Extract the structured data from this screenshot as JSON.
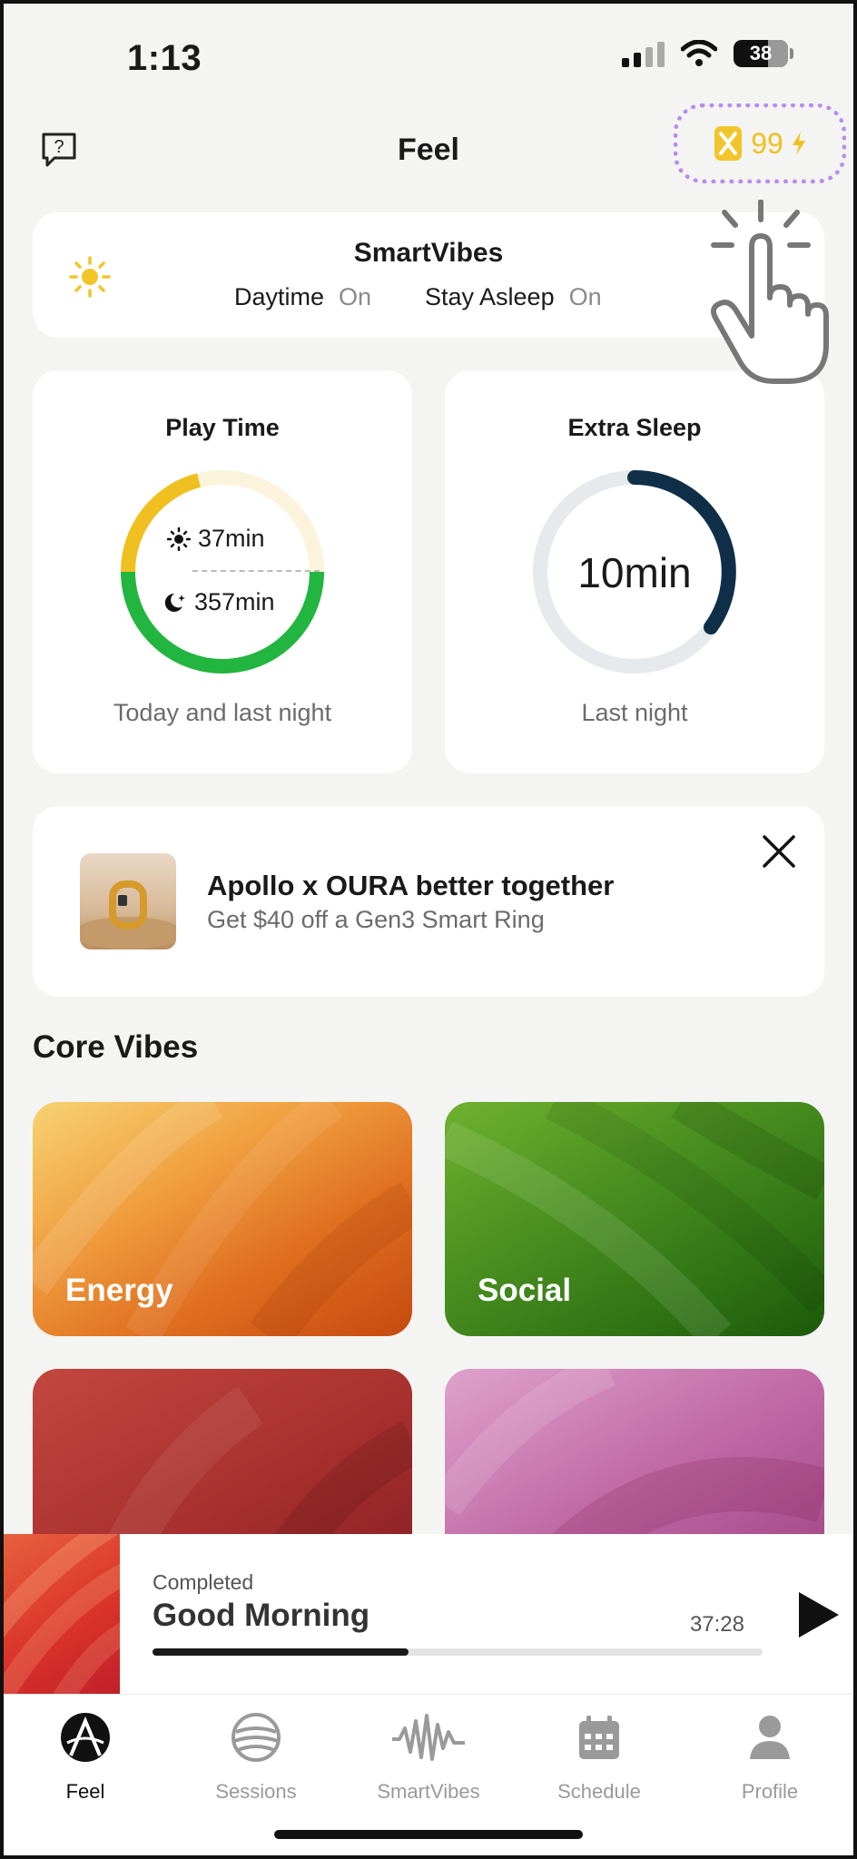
{
  "status_bar": {
    "time": "1:13",
    "battery": "38"
  },
  "header": {
    "title": "Feel",
    "coins": "99"
  },
  "smartvibes": {
    "title": "SmartVibes",
    "daytime_label": "Daytime",
    "daytime_value": "On",
    "stay_asleep_label": "Stay Asleep",
    "stay_asleep_value": "On"
  },
  "play_time": {
    "title": "Play Time",
    "day_value": "37min",
    "night_value": "357min",
    "subtitle": "Today and last night"
  },
  "extra_sleep": {
    "title": "Extra Sleep",
    "value": "10min",
    "subtitle": "Last night"
  },
  "promo": {
    "title": "Apollo x OURA better together",
    "subtitle": "Get $40 off a Gen3 Smart Ring"
  },
  "core_vibes": {
    "title": "Core Vibes",
    "items": [
      {
        "label": "Energy"
      },
      {
        "label": "Social"
      },
      {
        "label": ""
      },
      {
        "label": ""
      }
    ]
  },
  "now_playing": {
    "status": "Completed",
    "title": "Good Morning",
    "time": "37:28",
    "progress": 0.42
  },
  "tabs": [
    {
      "label": "Feel",
      "icon": "apollo-logo-icon",
      "active": true
    },
    {
      "label": "Sessions",
      "icon": "sessions-globe-icon",
      "active": false
    },
    {
      "label": "SmartVibes",
      "icon": "waveform-icon",
      "active": false
    },
    {
      "label": "Schedule",
      "icon": "calendar-icon",
      "active": false
    },
    {
      "label": "Profile",
      "icon": "person-icon",
      "active": false
    }
  ],
  "colors": {
    "background": "#f4f4f2",
    "coin_yellow": "#f0c020",
    "highlight_purple": "#b98bf0",
    "day_ring": "#f0c020",
    "night_ring": "#22b540",
    "sleep_ring": "#0f2f48"
  }
}
